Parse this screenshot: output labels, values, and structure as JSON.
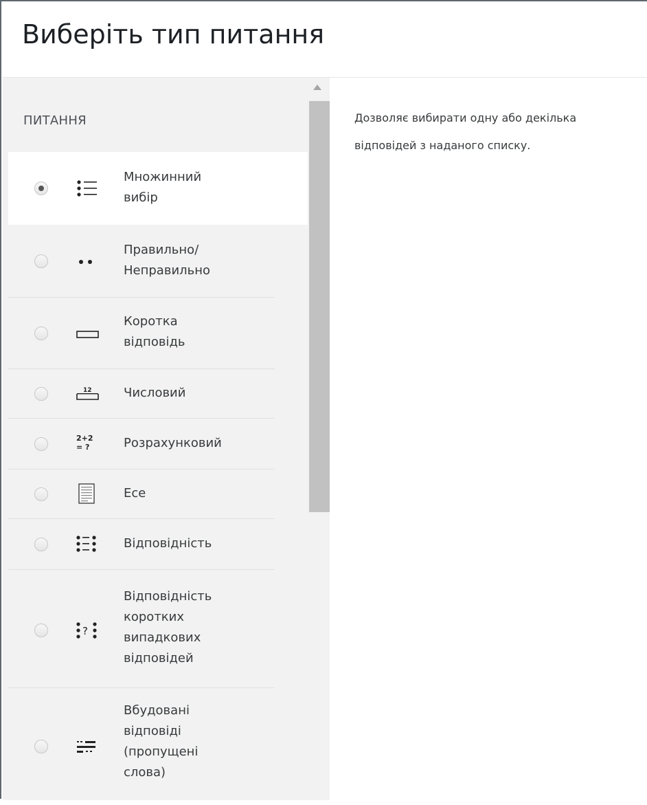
{
  "dialog": {
    "title": "Виберіть тип питання",
    "section_label": "ПИТАННЯ",
    "description": "Дозволяє вибирати одну або декілька\nвідповідей з наданого списку."
  },
  "question_types": [
    {
      "label": "Множинний\nвибір",
      "icon": "multichoice-icon",
      "selected": true
    },
    {
      "label": "Правильно/\nНеправильно",
      "icon": "truefalse-icon",
      "selected": false
    },
    {
      "label": "Коротка\nвідповідь",
      "icon": "shortanswer-icon",
      "selected": false
    },
    {
      "label": "Числовий",
      "icon": "numerical-icon",
      "icon_text": "12",
      "selected": false
    },
    {
      "label": "Розрахунковий",
      "icon": "calculated-icon",
      "icon_text": "2+2\n= ?",
      "selected": false
    },
    {
      "label": "Есе",
      "icon": "essay-icon",
      "selected": false
    },
    {
      "label": "Відповідність",
      "icon": "match-icon",
      "selected": false
    },
    {
      "label": "Відповідність\nкоротких\nвипадкових\nвідповідей",
      "icon": "randomsamatch-icon",
      "icon_text": "?",
      "selected": false
    },
    {
      "label": "Вбудовані\nвідповіді\n(пропущені\nслова)",
      "icon": "multianswer-icon",
      "selected": false
    }
  ],
  "colors": {
    "sidebar_bg": "#f2f2f2",
    "selected_bg": "#ffffff",
    "scroll_thumb": "#c1c1c1"
  }
}
